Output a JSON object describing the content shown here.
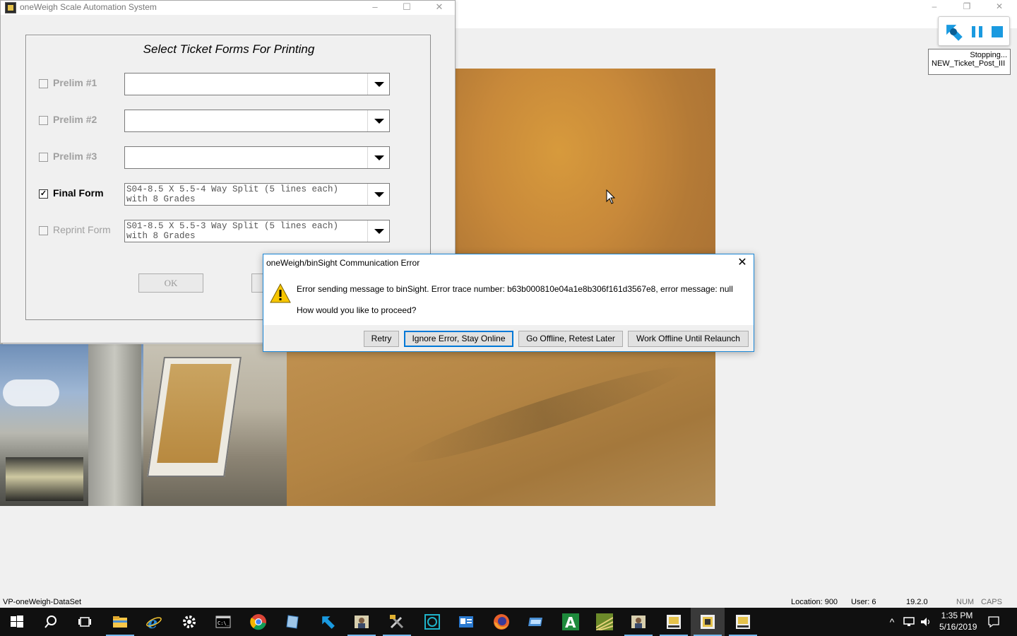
{
  "background_app": {
    "window_controls": [
      "–",
      "❐",
      "✕"
    ],
    "statusbar": {
      "dataset": "VP-oneWeigh-DataSet",
      "location": "Location: 900",
      "user": "User: 6",
      "version": "19.2.0",
      "num": "NUM",
      "caps": "CAPS"
    }
  },
  "automation_widget": {
    "tooltip_status": "Stopping...",
    "tooltip_job": "NEW_Ticket_Post_III",
    "accent_color": "#1a9ae0"
  },
  "ticket_window": {
    "title": "oneWeigh Scale Automation System",
    "controls": [
      "–",
      "☐",
      "✕"
    ],
    "heading": "Select Ticket Forms For Printing",
    "rows": [
      {
        "label": "Prelim #1",
        "checked": false,
        "check_mark": "",
        "value": ""
      },
      {
        "label": "Prelim #2",
        "checked": false,
        "check_mark": "",
        "value": ""
      },
      {
        "label": "Prelim #3",
        "checked": false,
        "check_mark": "",
        "value": ""
      },
      {
        "label": "Final Form",
        "checked": true,
        "check_mark": "✓",
        "value": "S04-8.5 X 5.5-4 Way Split (5 lines each)\nwith 8 Grades"
      },
      {
        "label": "Reprint Form",
        "checked": false,
        "check_mark": "",
        "value": "S01-8.5 X 5.5-3 Way Split (5 lines each)\nwith 8 Grades"
      }
    ],
    "ok_label": "OK"
  },
  "error_dialog": {
    "title": "oneWeigh/binSight Communication Error",
    "close": "✕",
    "message": "Error sending message to binSight. Error trace number: b63b000810e04a1e8b306f161d3567e8, error message: null",
    "question": "How would you like to proceed?",
    "buttons": {
      "retry": "Retry",
      "ignore": "Ignore Error, Stay Online",
      "go_offline": "Go Offline, Retest Later",
      "work_offline": "Work Offline Until Relaunch"
    },
    "border_color": "#1a86d6"
  },
  "taskbar": {
    "icons": [
      "windows-start-icon",
      "search-icon",
      "task-view-icon",
      "file-explorer-icon",
      "internet-explorer-icon",
      "settings-gear-icon",
      "terminal-icon",
      "chrome-icon",
      "notepad-icon",
      "automation-logo-icon",
      "app-person-icon",
      "tools-icon",
      "target-icon",
      "id-card-icon",
      "firefox-icon",
      "folder-app-icon",
      "app-a-icon",
      "field-icon",
      "app-person2-icon",
      "oneweigh-post-icon",
      "oneweigh-icon",
      "oneweigh-tiket-icon"
    ],
    "clock_time": "1:35 PM",
    "clock_date": "5/16/2019",
    "tray_chevron": "^"
  }
}
